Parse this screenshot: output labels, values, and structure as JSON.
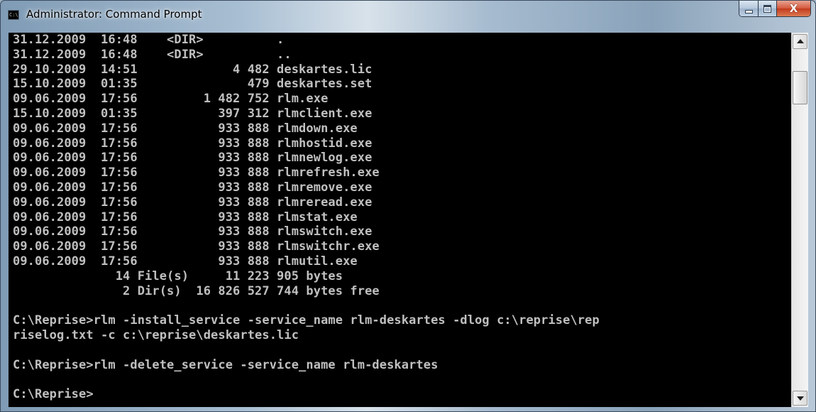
{
  "window": {
    "title": "Administrator: Command Prompt",
    "icon_label": "C:\\"
  },
  "controls": {
    "minimize": "minimize-icon",
    "maximize": "maximize-icon",
    "close_glyph": "X"
  },
  "console": {
    "lines": [
      "31.12.2009  16:48    <DIR>          .",
      "31.12.2009  16:48    <DIR>          ..",
      "29.10.2009  14:51             4 482 deskartes.lic",
      "15.10.2009  01:35               479 deskartes.set",
      "09.06.2009  17:56         1 482 752 rlm.exe",
      "15.10.2009  01:35           397 312 rlmclient.exe",
      "09.06.2009  17:56           933 888 rlmdown.exe",
      "09.06.2009  17:56           933 888 rlmhostid.exe",
      "09.06.2009  17:56           933 888 rlmnewlog.exe",
      "09.06.2009  17:56           933 888 rlmrefresh.exe",
      "09.06.2009  17:56           933 888 rlmremove.exe",
      "09.06.2009  17:56           933 888 rlmreread.exe",
      "09.06.2009  17:56           933 888 rlmstat.exe",
      "09.06.2009  17:56           933 888 rlmswitch.exe",
      "09.06.2009  17:56           933 888 rlmswitchr.exe",
      "09.06.2009  17:56           933 888 rlmutil.exe",
      "              14 File(s)     11 223 905 bytes",
      "               2 Dir(s)  16 826 527 744 bytes free",
      "",
      "C:\\Reprise>rlm -install_service -service_name rlm-deskartes -dlog c:\\reprise\\rep",
      "riselog.txt -c c:\\reprise\\deskartes.lic",
      "",
      "C:\\Reprise>rlm -delete_service -service_name rlm-deskartes",
      "",
      "C:\\Reprise>"
    ]
  }
}
